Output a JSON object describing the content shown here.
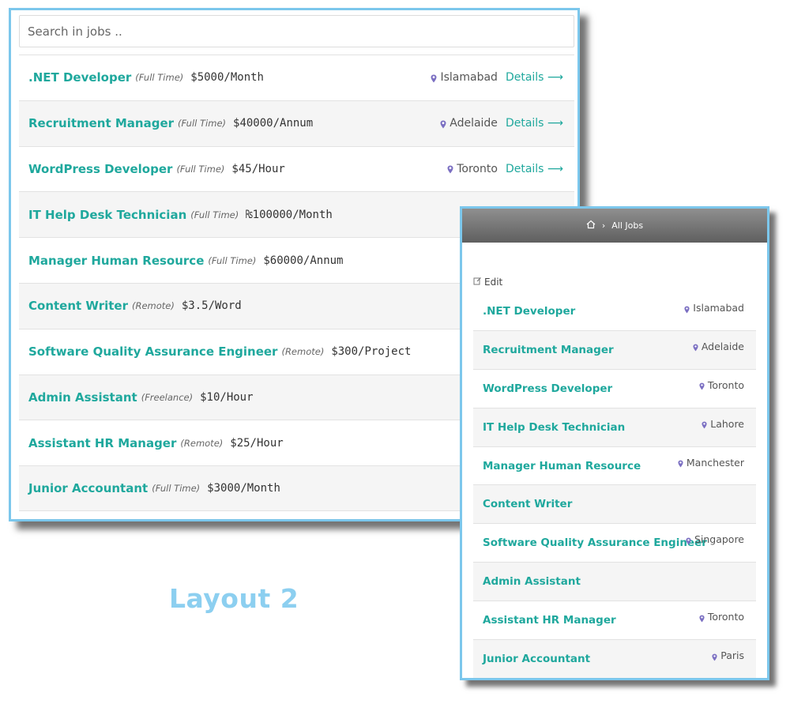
{
  "search": {
    "placeholder": "Search in jobs .."
  },
  "layout_label": "Layout 2",
  "details_label": "Details ⟶",
  "jobs": [
    {
      "title": ".NET Developer",
      "type": "(Full Time)",
      "salary": "$5000/Month",
      "location": "Islamabad"
    },
    {
      "title": "Recruitment Manager",
      "type": "(Full Time)",
      "salary": "$40000/Annum",
      "location": "Adelaide"
    },
    {
      "title": "WordPress Developer",
      "type": "(Full Time)",
      "salary": "$45/Hour",
      "location": "Toronto"
    },
    {
      "title": "IT Help Desk Technician",
      "type": "(Full Time)",
      "salary": "₨100000/Month",
      "location": "Lahore"
    },
    {
      "title": "Manager Human Resource",
      "type": "(Full Time)",
      "salary": "$60000/Annum",
      "location": "Manchester"
    },
    {
      "title": "Content Writer",
      "type": "(Remote)",
      "salary": "$3.5/Word",
      "location": ""
    },
    {
      "title": "Software Quality Assurance Engineer",
      "type": "(Remote)",
      "salary": "$300/Project",
      "location": "Singapore"
    },
    {
      "title": "Admin Assistant",
      "type": "(Freelance)",
      "salary": "$10/Hour",
      "location": ""
    },
    {
      "title": "Assistant HR Manager",
      "type": "(Remote)",
      "salary": "$25/Hour",
      "location": "Toronto"
    },
    {
      "title": "Junior Accountant",
      "type": "(Full Time)",
      "salary": "$3000/Month",
      "location": "Paris"
    }
  ],
  "panel_b": {
    "breadcrumb": {
      "current": "All Jobs"
    },
    "edit_label": "Edit"
  },
  "icons": {
    "home": "home-icon",
    "pin": "map-pin-icon",
    "edit": "edit-icon"
  },
  "colors": {
    "accent": "#1fa89d",
    "pin": "#7b6fc2",
    "frame": "#7cc7ec",
    "label": "#8ccff0"
  }
}
